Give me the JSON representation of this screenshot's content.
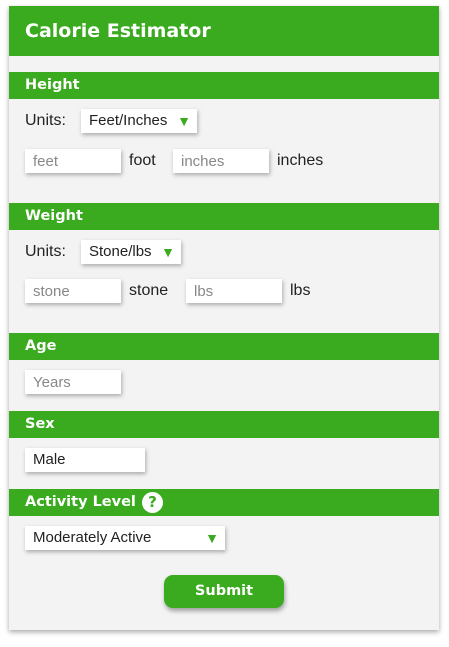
{
  "title": "Calorie Estimator",
  "colors": {
    "accent": "#3aaa1e",
    "panel": "#f3f3f3"
  },
  "height": {
    "heading": "Height",
    "units_label": "Units:",
    "units_value": "Feet/Inches",
    "feet_placeholder": "feet",
    "feet_unit": "foot",
    "inches_placeholder": "inches",
    "inches_unit": "inches"
  },
  "weight": {
    "heading": "Weight",
    "units_label": "Units:",
    "units_value": "Stone/lbs",
    "stone_placeholder": "stone",
    "stone_unit": "stone",
    "lbs_placeholder": "lbs",
    "lbs_unit": "lbs"
  },
  "age": {
    "heading": "Age",
    "placeholder": "Years"
  },
  "sex": {
    "heading": "Sex",
    "value": "Male"
  },
  "activity": {
    "heading": "Activity Level",
    "help_icon": "?",
    "value": "Moderately Active"
  },
  "dropdown_icon": "▼",
  "submit_label": "Submit"
}
